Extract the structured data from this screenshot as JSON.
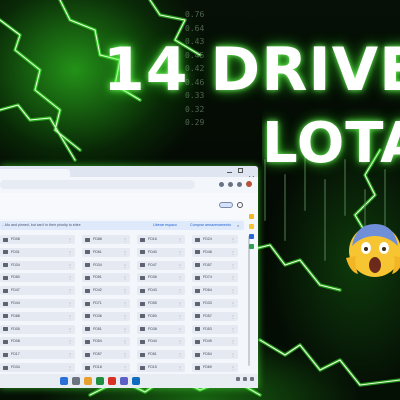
{
  "thumbnail": {
    "headline": "14 DRIVE",
    "subline": "LOTA",
    "price_ticker": [
      "0.76",
      "0.64",
      "0.43",
      "0.45",
      "0.42",
      "0.46",
      "0.33",
      "0.32",
      "0.29"
    ],
    "emoji": "face-screaming-in-fear"
  },
  "colors": {
    "glow": "#3cff28",
    "window_bg": "#f3f6fb",
    "tile_bg": "#e5eaf2",
    "banner_bg": "#dfe9fc",
    "accent": "#1a5fd0"
  },
  "browser": {
    "icons": [
      "extension-icon",
      "menu-icon",
      "profile-avatar"
    ]
  },
  "drive": {
    "banner": {
      "text": "...Mo and pinned, but can't in their priority to shire",
      "link1": "Liberar espaco",
      "link2": "Comprar armazenamento",
      "close": "×"
    },
    "folders": [
      [
        "FD08",
        "FD88",
        "FD16",
        "FD24"
      ],
      [
        "FD01",
        "FD61",
        "FD40",
        "FD48"
      ],
      [
        "FD34",
        "FD34",
        "FD47",
        "FD57"
      ],
      [
        "FD50",
        "FD51",
        "FD36",
        "FD74"
      ],
      [
        "FD47",
        "FD42",
        "FD43",
        "FD64"
      ],
      [
        "FD44",
        "FD71",
        "FD55",
        "FD33"
      ],
      [
        "FD88",
        "FD36",
        "FD50",
        "FD57"
      ],
      [
        "FD05",
        "FD51",
        "FD38",
        "FD53"
      ],
      [
        "FD08",
        "FD54",
        "FD44",
        "FD49"
      ],
      [
        "FD17",
        "FD57",
        "FD51",
        "FD54"
      ],
      [
        "FD34",
        "FD18",
        "FD15",
        "FD69"
      ]
    ]
  }
}
